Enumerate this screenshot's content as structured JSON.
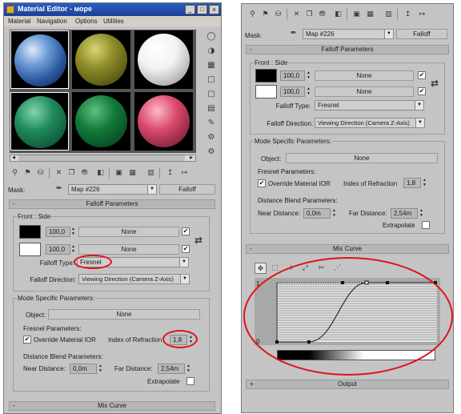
{
  "window": {
    "title": "Material Editor - море",
    "menu": [
      "Material",
      "Navigation",
      "Options",
      "Utilities"
    ],
    "controls": [
      "_",
      "□",
      "×"
    ]
  },
  "sample_slots": [
    {
      "name": "sky-blue",
      "color": "#6f9ed8"
    },
    {
      "name": "olive",
      "color": "#8c8a26"
    },
    {
      "name": "white",
      "color": "#f2f2f2"
    },
    {
      "name": "teal-green",
      "color": "#1f8a5c"
    },
    {
      "name": "green",
      "color": "#127a3a"
    },
    {
      "name": "pink",
      "color": "#d94a6c"
    }
  ],
  "toolbar": {
    "icons": [
      "get-material-icon",
      "put-material-icon",
      "assign-material-icon",
      "reset-icon",
      "make-copy-icon",
      "unique-icon",
      "put-library-icon",
      "material-id-icon",
      "show-map-icon",
      "show-end-result-icon",
      "go-to-parent-icon",
      "go-forward-icon"
    ],
    "glyphs": [
      "⚲",
      "⚑",
      "⛁",
      "✕",
      "❐",
      "⛃",
      "◧",
      "▣",
      "▦",
      "▥",
      "↥",
      "↦"
    ]
  },
  "mask_row": {
    "label": "Mask:",
    "map_name": "Map #226",
    "type_button": "Falloff"
  },
  "falloff": {
    "rollout_title": "Falloff Parameters",
    "rollout_sign": "-",
    "front_side_label": "Front : Side",
    "rows": [
      {
        "swatch": "#000000",
        "amount": "100,0",
        "map": "None",
        "checked": "✔"
      },
      {
        "swatch": "#ffffff",
        "amount": "100,0",
        "map": "None",
        "checked": "✔"
      }
    ],
    "swap_icon": "⇄",
    "type_label": "Falloff Type:",
    "type_value": "Fresnel",
    "direction_label": "Falloff Direction:",
    "direction_value": "Viewing Direction (Camera Z-Axis)"
  },
  "mode_specific": {
    "title": "Mode Specific Parameters:",
    "object_label": "Object:",
    "object_value": "None",
    "fresnel_label": "Fresnel Parameters:",
    "override_label": "Override Material IOR",
    "override_checked": "✔",
    "ior_label": "Index of Refraction",
    "ior_value": "1,8",
    "distance_label": "Distance Blend Parameters:",
    "near_label": "Near Distance:",
    "near_value": "0,0m",
    "far_label": "Far Distance:",
    "far_value": "2,54m",
    "extrapolate_label": "Extrapolate"
  },
  "mix_curve": {
    "rollout_title": "Mix Curve",
    "rollout_sign": "-",
    "tools": [
      "✥",
      "⬚",
      "+",
      "⤢",
      "✂",
      "⋰"
    ],
    "y_top": "1",
    "y_bottom": "0"
  },
  "output": {
    "rollout_title": "Output",
    "rollout_sign": "+"
  },
  "annotation_color": "#e0121a"
}
